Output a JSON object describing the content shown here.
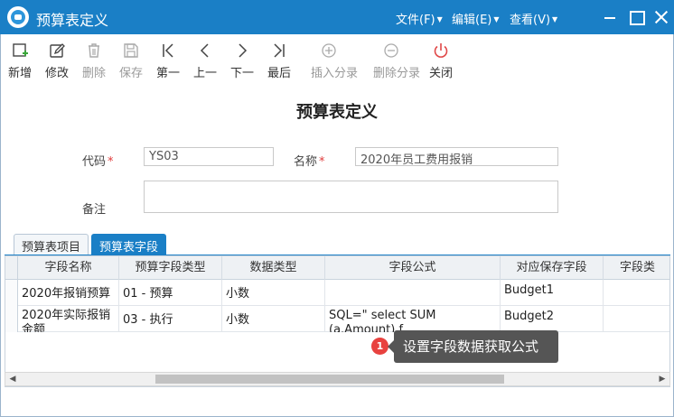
{
  "window": {
    "title": "预算表定义",
    "menus": [
      {
        "label": "文件(F)"
      },
      {
        "label": "编辑(E)"
      },
      {
        "label": "查看(V)"
      }
    ]
  },
  "toolbar": {
    "buttons": [
      {
        "label": "新增",
        "enabled": true
      },
      {
        "label": "修改",
        "enabled": true
      },
      {
        "label": "删除",
        "enabled": false
      },
      {
        "label": "保存",
        "enabled": false
      },
      {
        "label": "第一",
        "enabled": true
      },
      {
        "label": "上一",
        "enabled": true
      },
      {
        "label": "下一",
        "enabled": true
      },
      {
        "label": "最后",
        "enabled": true
      },
      {
        "label": "插入分录",
        "enabled": false
      },
      {
        "label": "删除分录",
        "enabled": false
      },
      {
        "label": "关闭",
        "enabled": true
      }
    ]
  },
  "form": {
    "title": "预算表定义",
    "code_label": "代码",
    "code_value": "YS03",
    "name_label": "名称",
    "name_value": "2020年员工费用报销",
    "note_label": "备注",
    "note_value": "",
    "required_mark": "*"
  },
  "tabs": [
    {
      "label": "预算表项目",
      "active": false
    },
    {
      "label": "预算表字段",
      "active": true
    }
  ],
  "grid": {
    "columns": [
      "字段名称",
      "预算字段类型",
      "数据类型",
      "字段公式",
      "对应保存字段",
      "字段类"
    ],
    "rows": [
      {
        "name": "2020年报销预算",
        "budget_type": "01 - 预算",
        "data_type": "小数",
        "formula": "",
        "save_field": "Budget1",
        "field_class": ""
      },
      {
        "name": "2020年实际报销金额",
        "budget_type": "03 - 执行",
        "data_type": "小数",
        "formula": "SQL=\" select SUM (a.Amount) f",
        "save_field": "Budget2",
        "field_class": ""
      }
    ]
  },
  "tooltip": {
    "step": "1",
    "text": "设置字段数据获取公式"
  },
  "colors": {
    "titlebar": "#1a7fc6",
    "active_tab": "#1a7fc6",
    "required": "#e03c3c",
    "tooltip_bg": "#555555",
    "badge": "#e8423f"
  }
}
